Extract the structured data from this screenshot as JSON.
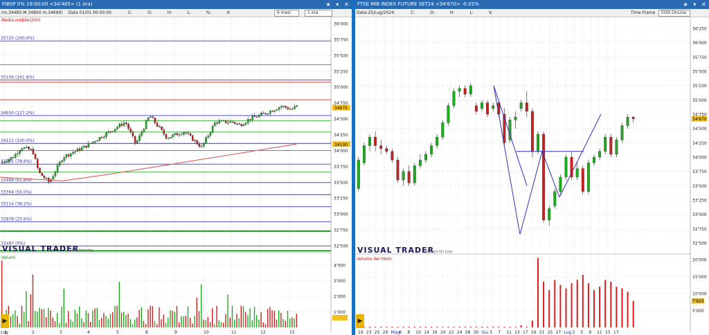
{
  "left": {
    "title": "FIBSP 0% 19:00:00 <34'485> (1 ora)",
    "toolbar": {
      "info": "(m.34485-M.34800 m.34690)",
      "date": "Data 01/01 00:00:00",
      "items": [
        "C:",
        "O:",
        "H:",
        "L:",
        "%:",
        "V:"
      ],
      "period": "6 mesi",
      "interval": "1 ora"
    },
    "moving_average_label": "Media mobile(200)",
    "logo": "VISUAL TRADER",
    "logo_sub": "Dati Intraday",
    "volume_label": "Volumi",
    "price_badge": "34675",
    "ma_badge": "34100",
    "fib_levels": [
      {
        "label": "35725 (200.0%)",
        "value": 35725
      },
      {
        "label": "35109 (161.8%)",
        "value": 35109
      },
      {
        "label": "34550 (127.2%)",
        "value": 34550
      },
      {
        "label": "34111 (100.0%)",
        "value": 34111
      },
      {
        "label": "33785 (78.6%)",
        "value": 33785
      },
      {
        "label": "33494 (61.8%)",
        "value": 33494
      },
      {
        "label": "33304 (50.0%)",
        "value": 33304
      },
      {
        "label": "33114 (38.2%)",
        "value": 33114
      },
      {
        "label": "32878 (23.6%)",
        "value": 32878
      },
      {
        "label": "32497 (0%)",
        "value": 32497
      }
    ],
    "price_ticks": [
      "36'000",
      "35'750",
      "35'500",
      "35'250",
      "35'000",
      "34'750",
      "34'500",
      "34'250",
      "34'000",
      "33'750",
      "33'500",
      "33'250",
      "33'000",
      "32'750",
      "32'500"
    ],
    "volume_ticks": [
      "4'000",
      "3'000",
      "2'000",
      "1'000"
    ],
    "x_ticks": [
      "1",
      "2",
      "3",
      "4",
      "5",
      "8",
      "9",
      "10",
      "11",
      "12",
      "15"
    ],
    "x_first": "Lug"
  },
  "right": {
    "title": "FTSE MIB INDEX FUTURE SET24 <34'670> -0.01%",
    "toolbar": {
      "date": "Data:25/Lug/2024",
      "items": [
        "C:",
        "O:",
        "H:",
        "L:",
        "V:"
      ],
      "time_frame_label": "Time Frame",
      "time_frame": "EOD OnLine"
    },
    "logo": "VISUAL TRADER",
    "logo_sub": "Storico On Line",
    "volume_label": "Volume del titolo",
    "price_badge": "34'670",
    "volume_badge": "7'825",
    "price_ticks": [
      "36'250",
      "36'000",
      "35'750",
      "35'500",
      "35'250",
      "35'000",
      "34'750",
      "34'500",
      "34'250",
      "34'000",
      "33'750",
      "33'500",
      "33'250",
      "33'000",
      "32'750",
      "32'500"
    ],
    "volume_ticks": [
      "20'000",
      "15'000",
      "10'000",
      "5'000"
    ],
    "x_ticks": [
      "19",
      "23",
      "25",
      "29",
      "Mag",
      "6",
      "8",
      "10",
      "14",
      "16",
      "20",
      "22",
      "24",
      "28",
      "30",
      "Giu",
      "5",
      "7",
      "11",
      "13",
      "17",
      "19",
      "21",
      "25",
      "27",
      "Lug",
      "3",
      "5",
      "9",
      "11",
      "15",
      "17"
    ]
  }
}
